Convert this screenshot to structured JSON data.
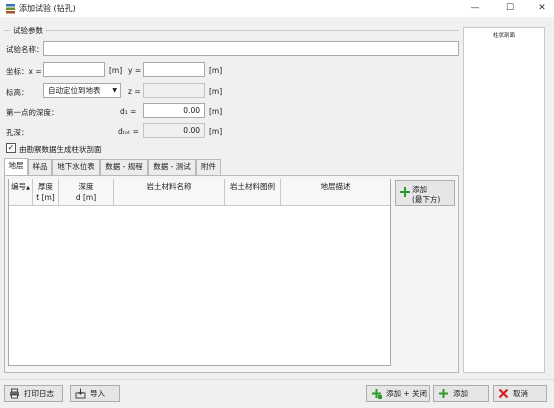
{
  "window": {
    "title": "添加试验 (钻孔)",
    "minimize_icon": "minimize-icon",
    "maximize_icon": "maximize-icon",
    "close_icon": "close-icon"
  },
  "params": {
    "group_title": "试验参数",
    "name_label": "试验名称：",
    "name_value": "",
    "coord_label": "坐标：x =",
    "x_value": "",
    "x_unit": "[m]",
    "y_label": "y =",
    "y_value": "",
    "y_unit": "[m]",
    "elev_label": "标高：",
    "elev_select": "自动定位到地表",
    "z_label": "z =",
    "z_value": "",
    "z_unit": "[m]",
    "first_depth_label": "第一点的深度：",
    "d1_label": "d₁ =",
    "d1_value": "0.00",
    "d1_unit": "[m]",
    "hole_depth_label": "孔深：",
    "dtot_label": "dₜₒₜ =",
    "dtot_value": "0.00",
    "dtot_unit": "[m]",
    "checkbox_label": "由勘察数据生成柱状剖面",
    "checkbox_checked": true
  },
  "tabs": [
    {
      "label": "地层",
      "active": true
    },
    {
      "label": "样品",
      "active": false
    },
    {
      "label": "地下水位表",
      "active": false
    },
    {
      "label": "数据 - 规程",
      "active": false
    },
    {
      "label": "数据 - 测试",
      "active": false
    },
    {
      "label": "附件",
      "active": false
    }
  ],
  "table": {
    "headers": {
      "no": "编号",
      "no_sort": "▲",
      "thickness": "厚度",
      "thickness_unit": "t [m]",
      "depth": "深度",
      "depth_unit": "d [m]",
      "material_name": "岩土材料名称",
      "material_legend": "岩土材料图例",
      "description": "地层描述"
    },
    "rows": []
  },
  "add_button": {
    "label_line1": "添加",
    "label_line2": "(最下方)"
  },
  "right_panel": {
    "title": "柱状剖面"
  },
  "footer": {
    "print_log": "打印日志",
    "import": "导入",
    "add_close": "添加 + 关闭",
    "add": "添加",
    "cancel": "取消"
  },
  "colors": {
    "add_green": "#2e9a2e",
    "cancel_red": "#d42020",
    "window_bg": "#f0f0f0"
  }
}
